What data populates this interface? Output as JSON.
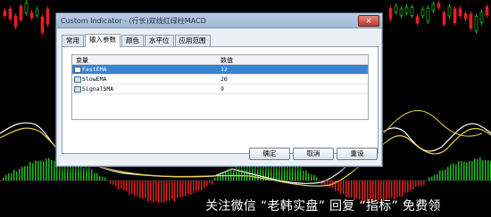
{
  "window": {
    "title": "Custom Indicator - (行长)双线红绿柱MACD",
    "close_symbol": "✕"
  },
  "tabs": [
    {
      "label": "常用"
    },
    {
      "label": "输入参数"
    },
    {
      "label": "颜色"
    },
    {
      "label": "水平位"
    },
    {
      "label": "应用范围"
    }
  ],
  "active_tab": "输入参数",
  "grid": {
    "col_variable": "变量",
    "col_value": "数值",
    "rows": [
      {
        "name": "FastEMA",
        "value": "12",
        "selected": true
      },
      {
        "name": "SlowEMA",
        "value": "26",
        "selected": false
      },
      {
        "name": "SignalSMA",
        "value": "9",
        "selected": false
      }
    ]
  },
  "buttons": {
    "ok": "确定",
    "cancel": "取消",
    "reset": "重设"
  },
  "watermark": "关注微信 “老韩实盘” 回复 “指标” 免费领",
  "colors": {
    "selection": "#3a83cf",
    "bull_bar": "#20c020",
    "bear_bar": "#e02020",
    "line_fast": "#ffffff",
    "line_slow": "#e6d24a"
  }
}
